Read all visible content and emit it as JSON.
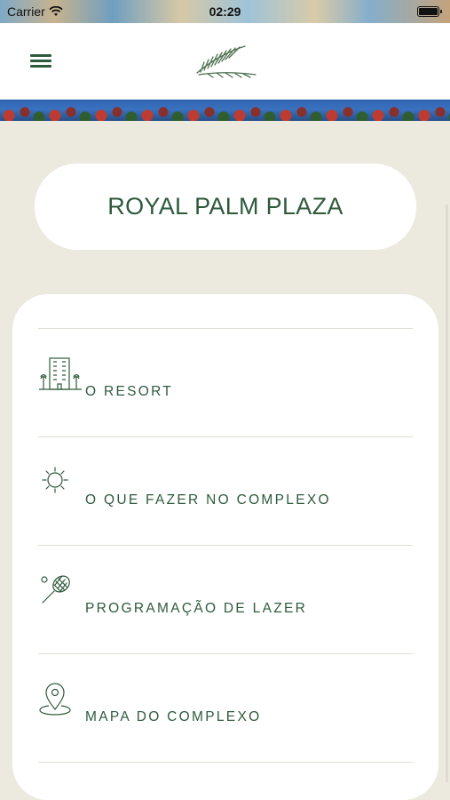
{
  "status_bar": {
    "carrier": "Carrier",
    "time": "02:29",
    "wifi_icon": "wifi-icon",
    "battery_icon": "battery-icon"
  },
  "nav": {
    "menu_icon": "hamburger-menu-icon",
    "logo_icon": "palm-leaf-logo-icon"
  },
  "header": {
    "title": "ROYAL PALM PLAZA"
  },
  "menu": {
    "items": [
      {
        "label": "O RESORT",
        "icon": "hotel-building-icon"
      },
      {
        "label": "O QUE FAZER NO COMPLEXO",
        "icon": "sun-icon"
      },
      {
        "label": "PROGRAMAÇÃO DE LAZER",
        "icon": "tennis-racket-icon"
      },
      {
        "label": "MAPA DO COMPLEXO",
        "icon": "map-pin-icon"
      }
    ]
  },
  "colors": {
    "accent": "#2e5a3c",
    "background": "#eceadf",
    "card": "#ffffff"
  }
}
